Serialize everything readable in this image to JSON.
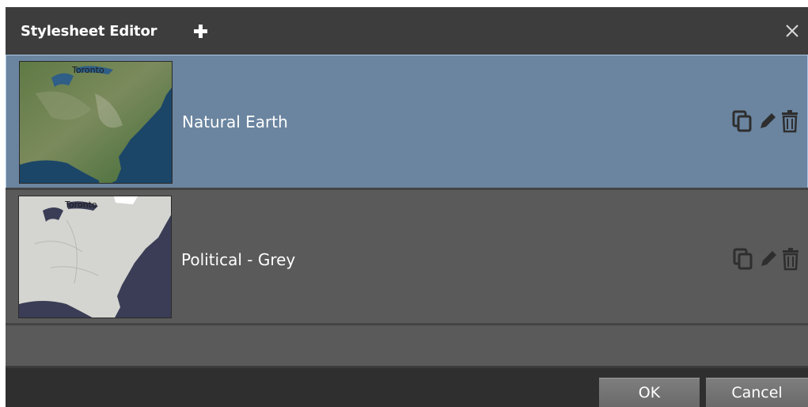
{
  "dialog": {
    "title": "Stylesheet Editor",
    "add_icon": "plus-icon",
    "close_icon": "close-icon"
  },
  "stylesheets": [
    {
      "label": "Natural Earth",
      "selected": true,
      "thumbnail_city": "Toronto",
      "actions": [
        "copy-icon",
        "edit-icon",
        "delete-icon"
      ]
    },
    {
      "label": "Political - Grey",
      "selected": false,
      "thumbnail_city": "Toronto",
      "actions": [
        "copy-icon",
        "edit-icon",
        "delete-icon"
      ]
    }
  ],
  "footer": {
    "ok_label": "OK",
    "cancel_label": "Cancel"
  },
  "colors": {
    "dialog_bg": "#3b3b3b",
    "selected_row": "#6b85a0",
    "selected_border": "#a9c6e4",
    "row_bg": "#5a5a5a",
    "icon_color": "#2e2e2e"
  }
}
